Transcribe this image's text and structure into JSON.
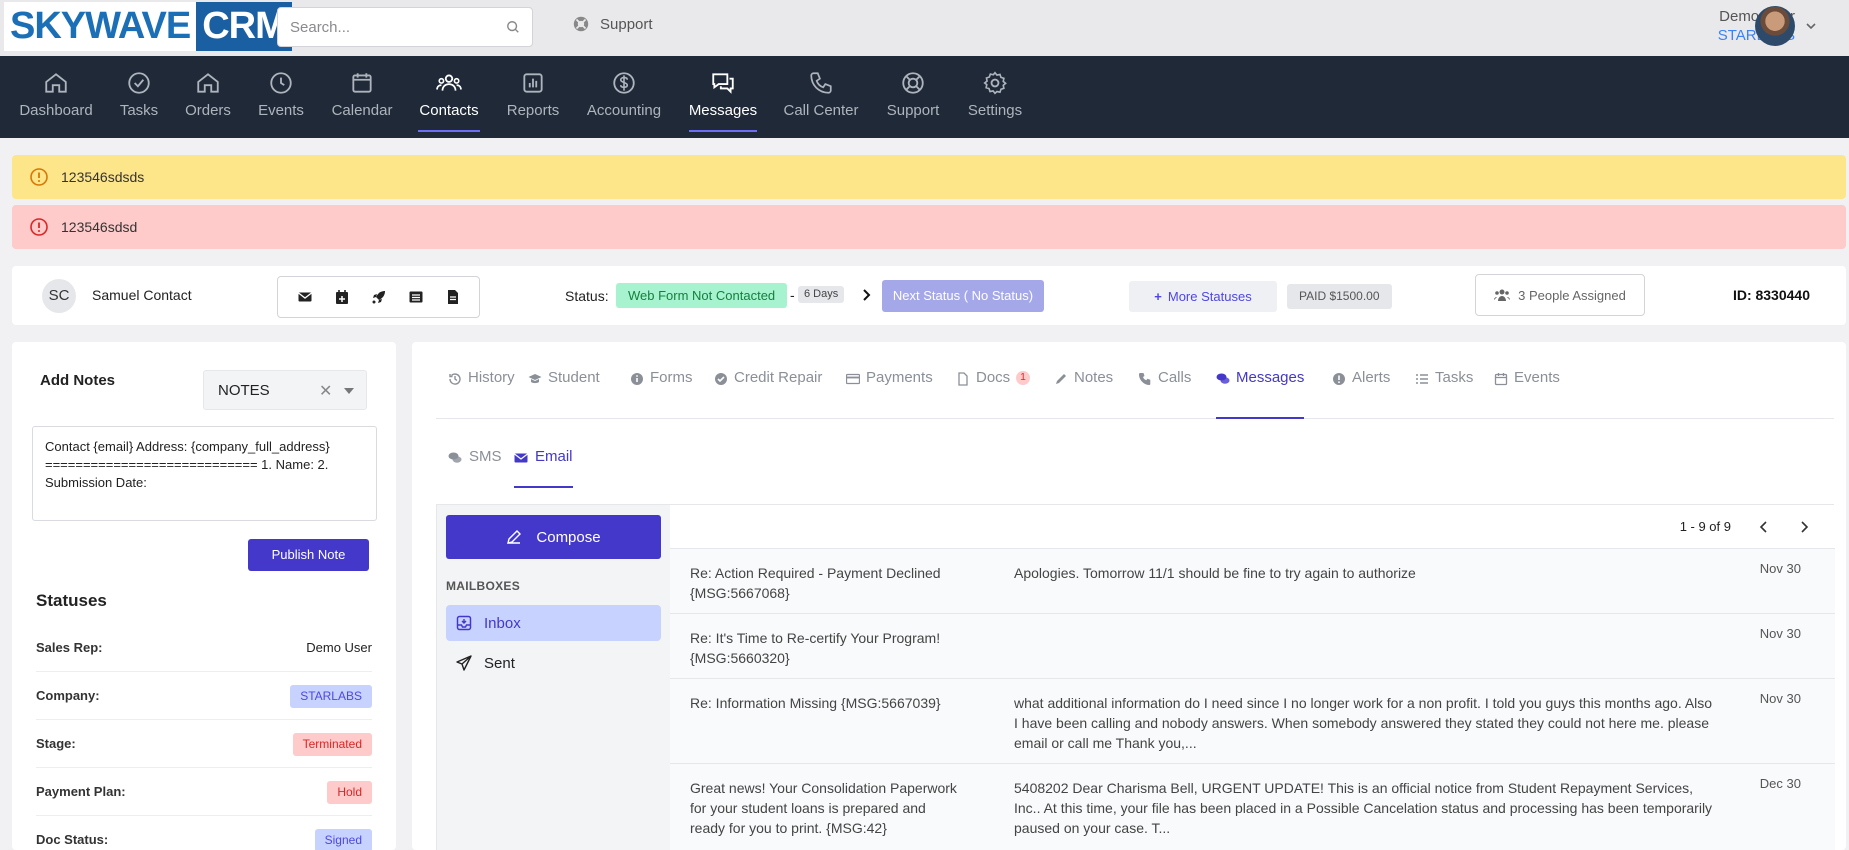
{
  "brand": {
    "logo_left": "SKYWAVE",
    "logo_right": "CRM"
  },
  "search": {
    "placeholder": "Search..."
  },
  "top_support": "Support",
  "user": {
    "name": "Demo User",
    "company": "STARLABS"
  },
  "nav": [
    {
      "label": "Dashboard",
      "icon": "home-icon"
    },
    {
      "label": "Tasks",
      "icon": "check-circle-icon"
    },
    {
      "label": "Orders",
      "icon": "home-icon"
    },
    {
      "label": "Events",
      "icon": "clock-icon"
    },
    {
      "label": "Calendar",
      "icon": "calendar-icon"
    },
    {
      "label": "Contacts",
      "icon": "users-icon",
      "active": true
    },
    {
      "label": "Reports",
      "icon": "chart-icon"
    },
    {
      "label": "Accounting",
      "icon": "dollar-icon"
    },
    {
      "label": "Messages",
      "icon": "chat-icon",
      "active": true
    },
    {
      "label": "Call Center",
      "icon": "phone-icon"
    },
    {
      "label": "Support",
      "icon": "lifebuoy-icon"
    },
    {
      "label": "Settings",
      "icon": "gear-icon"
    }
  ],
  "alerts": {
    "warning": "123546sdsds",
    "error": "123546sdsd"
  },
  "contact": {
    "initials": "SC",
    "name": "Samuel Contact",
    "status_label": "Status:",
    "status": "Web Form Not Contacted",
    "dash": "-",
    "days": "6 Days",
    "next_status": "Next Status ( No Status)",
    "more_statuses": "More Statuses",
    "paid": "PAID $1500.00",
    "people": "3 People Assigned",
    "id": "ID: 8330440"
  },
  "notes": {
    "title": "Add Notes",
    "select_value": "NOTES",
    "text": "Contact {email} Address: {company_full_address} ============================ 1. Name: 2. Submission Date:",
    "publish": "Publish Note"
  },
  "statuses": {
    "title": "Statuses",
    "rows": [
      {
        "key": "Sales Rep:",
        "value": "Demo User"
      },
      {
        "key": "Company:",
        "value": "STARLABS"
      },
      {
        "key": "Stage:",
        "value": "Terminated"
      },
      {
        "key": "Payment Plan:",
        "value": "Hold"
      },
      {
        "key": "Doc Status:",
        "value": "Signed"
      }
    ]
  },
  "tabs": [
    {
      "label": "History"
    },
    {
      "label": "Student"
    },
    {
      "label": "Forms"
    },
    {
      "label": "Credit Repair"
    },
    {
      "label": "Payments"
    },
    {
      "label": "Docs",
      "count": "1"
    },
    {
      "label": "Notes"
    },
    {
      "label": "Calls"
    },
    {
      "label": "Messages",
      "active": true
    },
    {
      "label": "Alerts"
    },
    {
      "label": "Tasks"
    },
    {
      "label": "Events"
    }
  ],
  "subtabs": [
    {
      "label": "SMS"
    },
    {
      "label": "Email",
      "active": true
    }
  ],
  "mailbox": {
    "compose": "Compose",
    "heading": "MAILBOXES",
    "inbox": "Inbox",
    "sent": "Sent",
    "pager": "1 - 9 of 9"
  },
  "messages": [
    {
      "subject": "Re: Action Required - Payment Declined {MSG:5667068}",
      "preview": "Apologies. Tomorrow 11/1 should be fine to try again to authorize",
      "date": "Nov 30"
    },
    {
      "subject": "Re: It's Time to Re-certify Your Program! {MSG:5660320}",
      "preview": "",
      "date": "Nov 30"
    },
    {
      "subject": "Re: Information Missing {MSG:5667039}",
      "preview": "what additional information do I need since I no longer work for a non profit. I told you guys this months ago. Also I have been calling and nobody answers. When somebody answered they stated they could not here me. please email or call me Thank you,...",
      "date": "Nov 30"
    },
    {
      "subject": "Great news! Your Consolidation Paperwork for your student loans is prepared and ready for you to print. {MSG:42}",
      "preview": "5408202 Dear Charisma Bell, URGENT UPDATE! This is an official notice from Student Repayment Services, Inc.. At this time, your file has been placed in a Possible Cancelation status and processing has been temporarily paused on your case. T...",
      "date": "Dec 30"
    }
  ]
}
